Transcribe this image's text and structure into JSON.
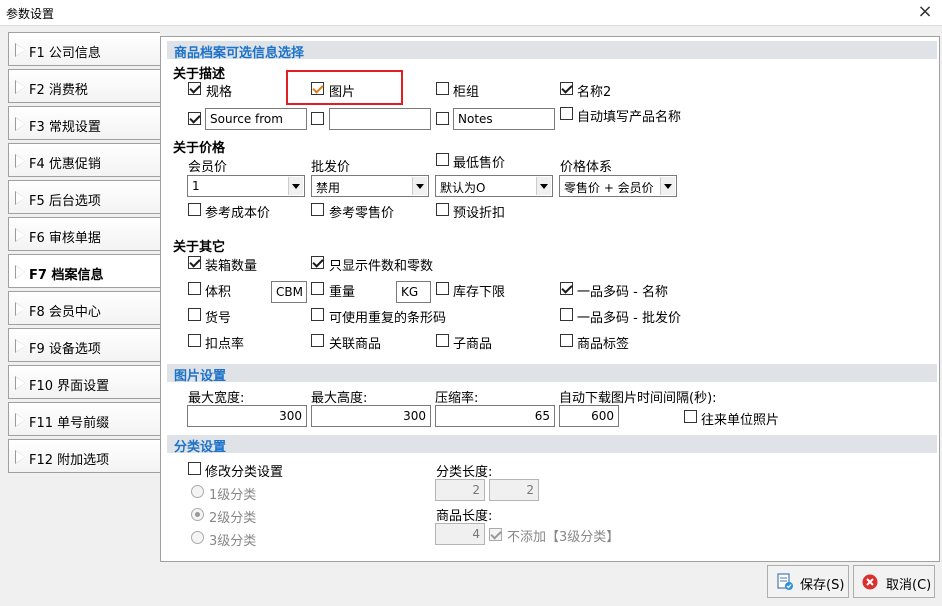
{
  "window": {
    "title": "参数设置",
    "close_symbol": "×"
  },
  "nav": [
    {
      "label": "F1 公司信息"
    },
    {
      "label": "F2 消费税"
    },
    {
      "label": "F3 常规设置"
    },
    {
      "label": "F4 优惠促销"
    },
    {
      "label": "F5 后台选项"
    },
    {
      "label": "F6 审核单据"
    },
    {
      "label": "F7 档案信息",
      "active": true
    },
    {
      "label": "F8 会员中心"
    },
    {
      "label": "F9 设备选项"
    },
    {
      "label": "F10 界面设置"
    },
    {
      "label": "F11 单号前缀"
    },
    {
      "label": "F12 附加选项"
    }
  ],
  "sections": {
    "optional_info": "商品档案可选信息选择",
    "image_settings": "图片设置",
    "category_settings": "分类设置"
  },
  "describe": {
    "title": "关于描述",
    "spec": {
      "label": "规格",
      "checked": true
    },
    "image": {
      "label": "图片",
      "checked": true
    },
    "cabinet": {
      "label": "柜组",
      "checked": false
    },
    "name2": {
      "label": "名称2",
      "checked": true
    },
    "source_from": {
      "value": "Source from",
      "checked": true
    },
    "blank_field": {
      "value": "",
      "checked": false
    },
    "notes": {
      "value": "Notes",
      "checked": false
    },
    "autofill_name": {
      "label": "自动填写产品名称",
      "checked": false
    }
  },
  "price": {
    "title": "关于价格",
    "member_price": {
      "label": "会员价",
      "value": "1"
    },
    "wholesale_price": {
      "label": "批发价",
      "value": "禁用"
    },
    "min_price": {
      "label": "最低售价",
      "checked": false,
      "value": "默认为O"
    },
    "price_system": {
      "label": "价格体系",
      "value": "零售价 + 会员价"
    },
    "ref_cost": {
      "label": "参考成本价",
      "checked": false
    },
    "ref_retail": {
      "label": "参考零售价",
      "checked": false
    },
    "preset_discount": {
      "label": "预设折扣",
      "checked": false
    }
  },
  "other": {
    "title": "关于其它",
    "box_qty": {
      "label": "装箱数量",
      "checked": true
    },
    "show_pieces": {
      "label": "只显示件数和零数",
      "checked": true
    },
    "volume": {
      "label": "体积",
      "checked": false,
      "unit": "CBM"
    },
    "weight": {
      "label": "重量",
      "checked": false,
      "unit": "KG"
    },
    "stock_floor": {
      "label": "库存下限",
      "checked": false
    },
    "multi_code_name": {
      "label": "一品多码 - 名称",
      "checked": true
    },
    "shelf_no": {
      "label": "货号",
      "checked": false
    },
    "dup_barcode": {
      "label": "可使用重复的条形码",
      "checked": false
    },
    "multi_code_wholesale": {
      "label": "一品多码 - 批发价",
      "checked": false
    },
    "deduct_rate": {
      "label": "扣点率",
      "checked": false
    },
    "related_goods": {
      "label": "关联商品",
      "checked": false
    },
    "sub_goods": {
      "label": "子商品",
      "checked": false
    },
    "goods_tag": {
      "label": "商品标签",
      "checked": false
    }
  },
  "image": {
    "max_width": {
      "label": "最大宽度:",
      "value": "300"
    },
    "max_height": {
      "label": "最大高度:",
      "value": "300"
    },
    "compression": {
      "label": "压缩率:",
      "value": "65"
    },
    "auto_interval": {
      "label": "自动下载图片时间间隔(秒):",
      "value": "600"
    },
    "partner_photo": {
      "label": "往来单位照片",
      "checked": false
    }
  },
  "category": {
    "modify": {
      "label": "修改分类设置",
      "checked": false
    },
    "level1": {
      "label": "1级分类",
      "selected": false
    },
    "level2": {
      "label": "2级分类",
      "selected": true
    },
    "level3": {
      "label": "3级分类",
      "selected": false
    },
    "cat_length": {
      "label": "分类长度:",
      "v1": "2",
      "v2": "2"
    },
    "goods_length": {
      "label": "商品长度:",
      "value": "4"
    },
    "no_add": {
      "label": "不添加【3级分类】",
      "checked": true
    }
  },
  "buttons": {
    "save": "保存(S)",
    "cancel": "取消(C)"
  },
  "colors": {
    "section_title": "#1e73c8",
    "highlight_box": "#e02020"
  }
}
